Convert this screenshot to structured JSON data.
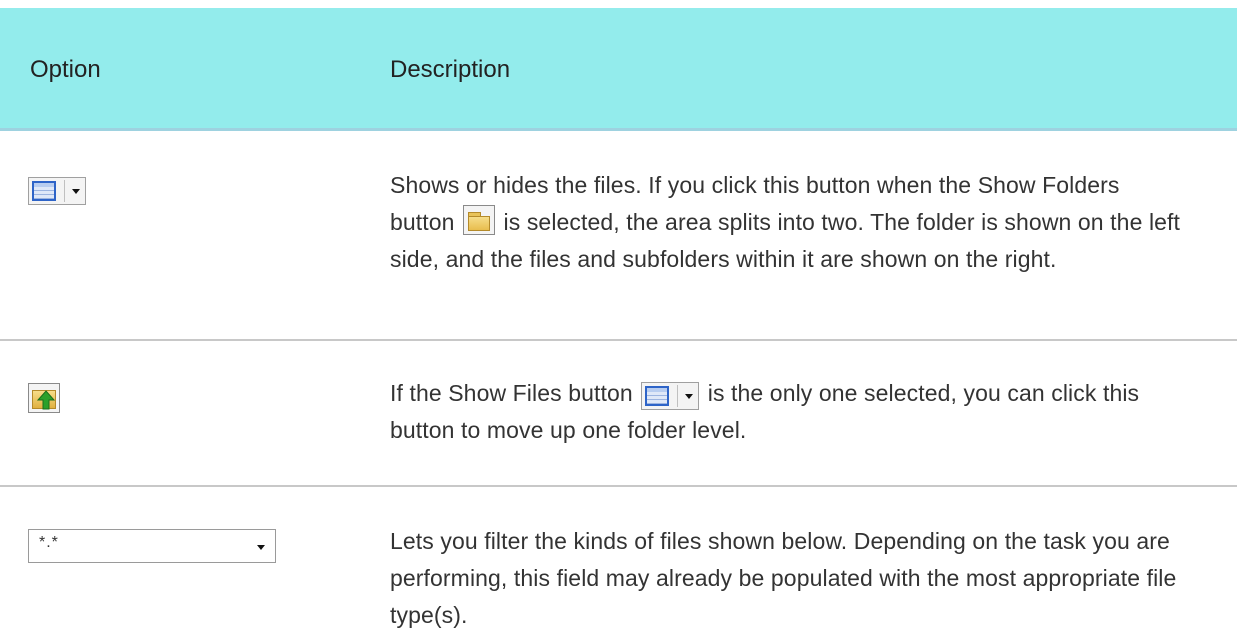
{
  "table": {
    "headers": {
      "option": "Option",
      "description": "Description"
    },
    "rows": [
      {
        "option_icon": "show-files-button-icon",
        "description_parts": [
          "Shows or hides the files. If you click this button when the Show Folders button ",
          " is selected, the area splits into two. The folder is shown on the left side, and the files and subfolders within it are shown on the right."
        ],
        "inline_icon": "show-folders-button-icon"
      },
      {
        "option_icon": "up-one-level-button-icon",
        "description_parts": [
          "If the Show Files button ",
          " is the only one selected, you can click this button to move up one folder level."
        ],
        "inline_icon": "show-files-button-icon"
      },
      {
        "option_icon": "file-filter-dropdown",
        "filter_value": "*.*",
        "description": "Lets you filter the kinds of files shown below. Depending on the task you are performing, this field may already be populated with the most appropriate file type(s)."
      }
    ]
  },
  "colors": {
    "header_bg": "#93ecec",
    "header_border": "#9ed2e0",
    "divider": "#c8c8c8",
    "text": "#333333"
  }
}
